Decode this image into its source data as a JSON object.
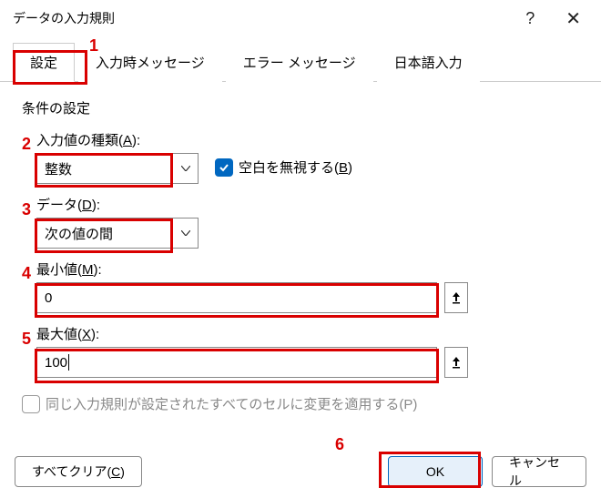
{
  "title": "データの入力規則",
  "tabs": {
    "settings": "設定",
    "input_msg": "入力時メッセージ",
    "error_msg": "エラー メッセージ",
    "ime": "日本語入力"
  },
  "group": "条件の設定",
  "allow_label_pre": "入力値の種類(",
  "allow_hotkey": "A",
  "allow_label_post": "):",
  "allow_value": "整数",
  "ignore_blank_pre": "空白を無視する(",
  "ignore_blank_hotkey": "B",
  "ignore_blank_post": ")",
  "data_label_pre": "データ(",
  "data_hotkey": "D",
  "data_label_post": "):",
  "data_value": "次の値の間",
  "min_label_pre": "最小値(",
  "min_hotkey": "M",
  "min_label_post": "):",
  "min_value": "0",
  "max_label_pre": "最大値(",
  "max_hotkey": "X",
  "max_label_post": "):",
  "max_value": "100",
  "apply_all_pre": "同じ入力規則が設定されたすべてのセルに変更を適用する(",
  "apply_all_hotkey": "P",
  "apply_all_post": ")",
  "clear_pre": "すべてクリア(",
  "clear_hotkey": "C",
  "clear_post": ")",
  "ok": "OK",
  "cancel": "キャンセル",
  "markers": {
    "m1": "1",
    "m2": "2",
    "m3": "3",
    "m4": "4",
    "m5": "5",
    "m6": "6"
  }
}
